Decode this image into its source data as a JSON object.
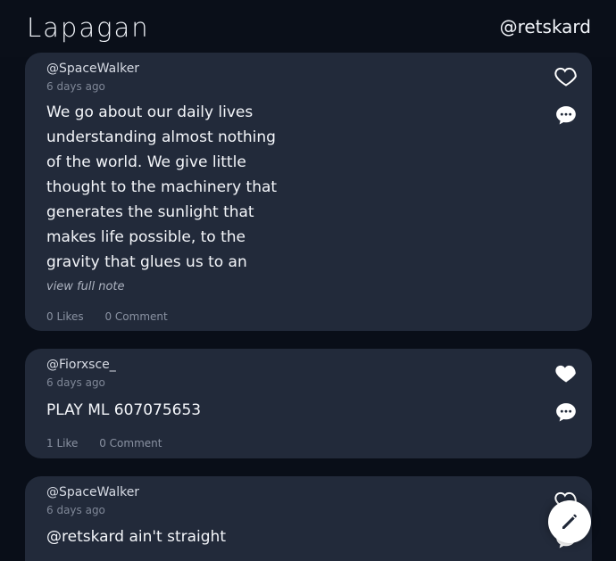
{
  "header": {
    "brand": "Lapagan",
    "user": "@retskard"
  },
  "posts": [
    {
      "author": "@SpaceWalker",
      "time": "6 days ago",
      "body": "We go about our daily lives\nunderstanding almost nothing\nof the world. We give little\nthought to the machinery that\ngenerates the sunlight that\nmakes life possible, to the\ngravity that glues us to an",
      "view_full_note": "view full note",
      "likes": "0 Likes",
      "comments": "0 Comment",
      "liked": false
    },
    {
      "author": "@Fiorxsce_",
      "time": "6 days ago",
      "body": "PLAY ML 607075653",
      "likes": "1 Like",
      "comments": "0 Comment",
      "liked": true
    },
    {
      "author": "@SpaceWalker",
      "time": "6 days ago",
      "body": "@retskard ain't straight",
      "liked": false
    }
  ],
  "icons": {
    "heart": "heart-icon",
    "comment": "comment-icon",
    "compose": "pencil-icon"
  },
  "colors": {
    "background": "#090e18",
    "card": "#222a3a",
    "text": "#f4f6fa",
    "muted": "#7f8797"
  }
}
